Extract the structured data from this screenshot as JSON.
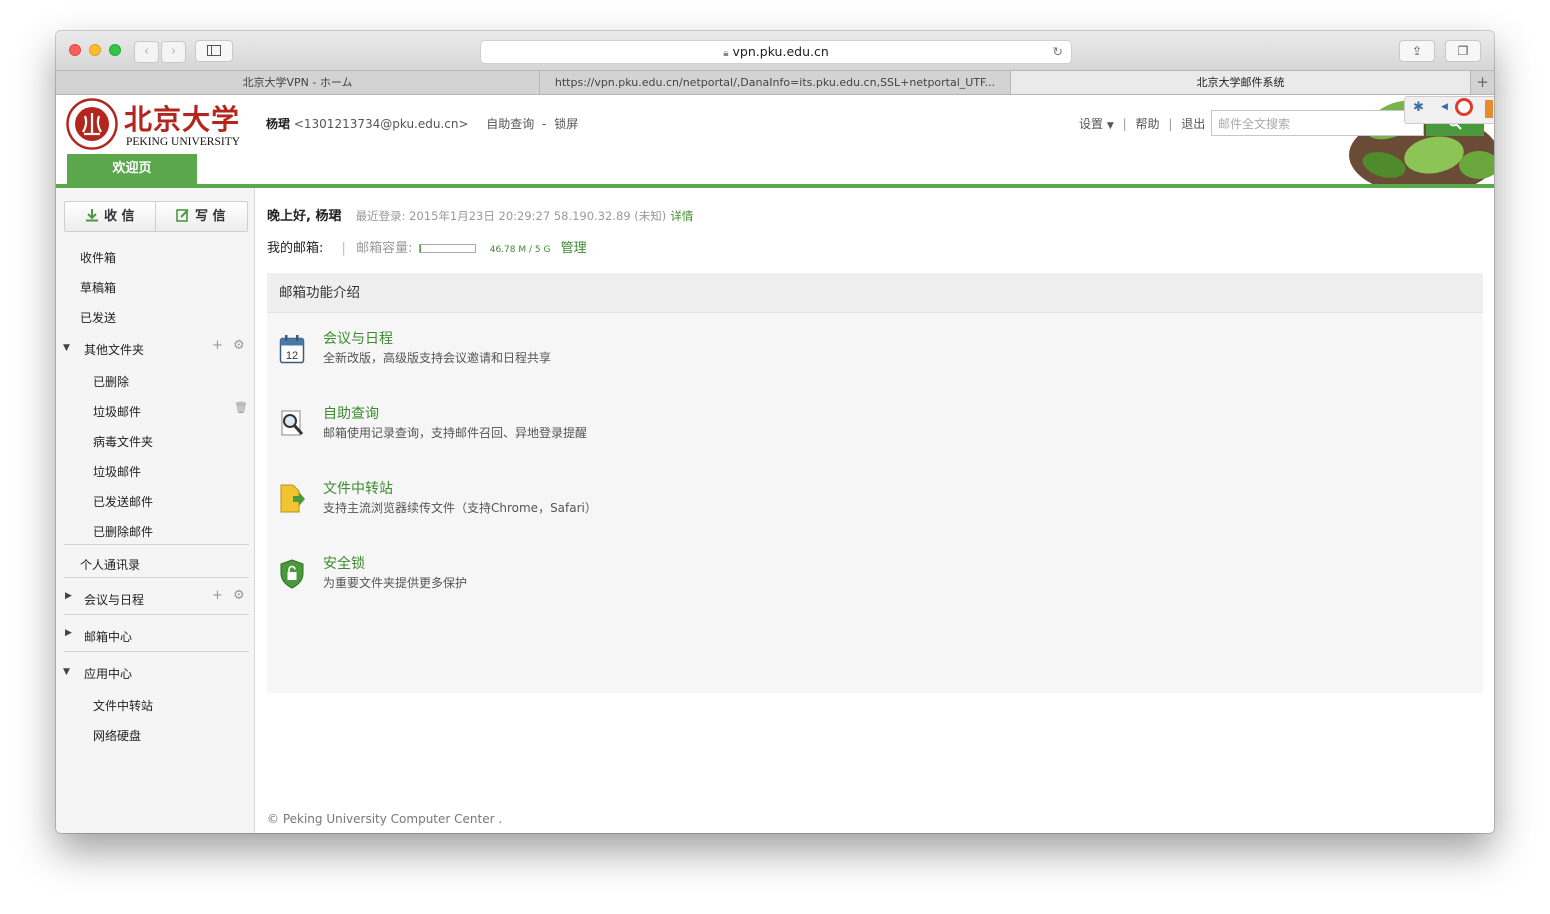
{
  "browser": {
    "url": "vpn.pku.edu.cn",
    "tabs": [
      {
        "label": "北京大学VPN - ホーム"
      },
      {
        "label": "https://vpn.pku.edu.cn/netportal/,DanaInfo=its.pku.edu.cn,SSL+netportal_UTF..."
      },
      {
        "label": "北京大学邮件系统"
      }
    ]
  },
  "header": {
    "logo_cn": "北京大学",
    "logo_en": "PEKING UNIVERSITY",
    "user_name": "杨珺",
    "user_email": "<1301213734@pku.edu.cn>",
    "self_service": "自助查询",
    "dash": "-",
    "lock": "锁屏",
    "settings": "设置",
    "help": "帮助",
    "logout": "退出",
    "separator": "|",
    "search_placeholder": "邮件全文搜索",
    "welcome_tab": "欢迎页"
  },
  "sidebar": {
    "receive": "收 信",
    "compose": "写 信",
    "inbox": "收件箱",
    "drafts": "草稿箱",
    "sent": "已发送",
    "other_folders": "其他文件夹",
    "folders": [
      "已删除",
      "垃圾邮件",
      "病毒文件夹",
      "垃圾邮件",
      "已发送邮件",
      "已删除邮件"
    ],
    "contacts": "个人通讯录",
    "calendar": "会议与日程",
    "mail_center": "邮箱中心",
    "app_center": "应用中心",
    "apps": [
      "文件中转站",
      "网络硬盘"
    ]
  },
  "main": {
    "greeting": "晚上好, 杨珺",
    "last_login": "最近登录: 2015年1月23日 20:29:27 58.190.32.89 (未知)",
    "details": "详情",
    "my_mailbox": "我的邮箱:",
    "capacity_label": "邮箱容量:",
    "capacity_value": "46.78 M / 5 G",
    "capacity_fraction": 0.009,
    "manage": "管理",
    "panel_title": "邮箱功能介绍",
    "features": [
      {
        "title": "会议与日程",
        "desc": "全新改版，高级版支持会议邀请和日程共享",
        "icon": "calendar-icon",
        "day": "12"
      },
      {
        "title": "自助查询",
        "desc": "邮箱使用记录查询，支持邮件召回、异地登录提醒",
        "icon": "search-doc-icon"
      },
      {
        "title": "文件中转站",
        "desc": "支持主流浏览器续传文件（支持Chrome，Safari）",
        "icon": "file-transfer-icon"
      },
      {
        "title": "安全锁",
        "desc": "为重要文件夹提供更多保护",
        "icon": "shield-lock-icon"
      }
    ],
    "footer": "© Peking University Computer Center ."
  },
  "colors": {
    "accent": "#5aa84b",
    "link": "#3d8b2f"
  }
}
